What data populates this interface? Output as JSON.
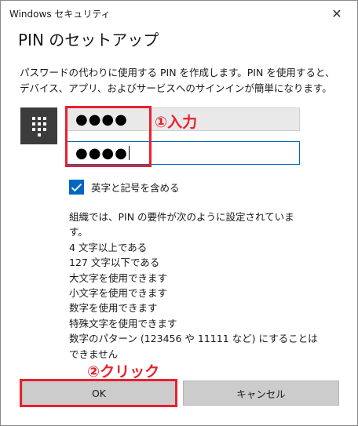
{
  "window": {
    "title": "Windows セキュリティ",
    "close_label": "✕"
  },
  "heading": "PIN のセットアップ",
  "description": "パスワードの代わりに使用する PIN を作成します。PIN を使用すると、デバイス、アプリ、およびサービスへのサインインが簡単になります。",
  "pin": {
    "new_value": "●●●●",
    "confirm_value": "●●●●"
  },
  "checkbox": {
    "label": "英字と記号を含める",
    "checked": true
  },
  "policy": {
    "intro_lines": [
      "組織では、PIN の要件が次のように設定されていま",
      "す。"
    ],
    "rules": [
      "4 文字以上である",
      "127 文字以下である",
      "大文字を使用できます",
      "小文字を使用できます",
      "数字を使用できます",
      "特殊文字を使用できます",
      "数字のパターン (123456 や 11111 など) にすることは",
      "できません"
    ]
  },
  "buttons": {
    "ok": "OK",
    "cancel": "キャンセル"
  },
  "annotations": {
    "step1": "①入力",
    "step2": "②クリック"
  },
  "colors": {
    "accent": "#0067c0",
    "annotation": "#e8212e",
    "keypad": "#3c3c3c"
  }
}
